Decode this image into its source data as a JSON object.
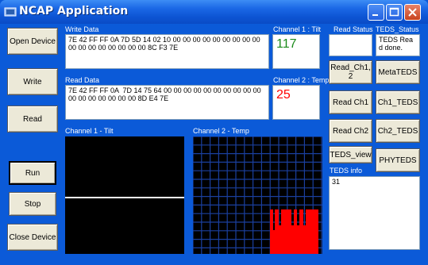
{
  "window": {
    "title": "NCAP Application"
  },
  "buttons": {
    "open_device": "Open Device",
    "write": "Write",
    "read": "Read",
    "run": "Run",
    "stop": "Stop",
    "close_device": "Close Device",
    "read_ch12": "Read_Ch1, 2",
    "meta_teds": "MetaTEDS",
    "read_ch1": "Read Ch1",
    "ch1_teds": "Ch1_TEDS",
    "read_ch2": "Read Ch2",
    "ch2_teds": "Ch2_TEDS",
    "teds_view": "TEDS_view",
    "phy_teds": "PHYTEDS"
  },
  "labels": {
    "write_data": "Write Data",
    "read_data": "Read Data",
    "channel1_tilt_value": "Channel 1 : Tilt",
    "channel2_temp_value": "Channel 2 : Temp",
    "read_status": "Read Status",
    "teds_status": "TEDS_Status",
    "channel1_plot": "Channel 1 - Tilt",
    "channel2_plot": "Channel 2 - Temp",
    "teds_info": "TEDS info"
  },
  "fields": {
    "write_data": "7E 42 FF FF 0A 7D 5D 14 02 10 00 00 00 00 00 00 00 00 00 00 00 00 00 00 00 00 00 8C F3 7E",
    "read_data": "7E 42 FF FF 0A  7D 14 75 64 00 00 00 00 00 00 00 00 00 00 00 00 00 00 00 00 00 8D E4 7E",
    "channel1_value": "117",
    "channel2_value": "25",
    "read_status": "",
    "teds_status": "TEDS Read done.",
    "teds_info": "31"
  },
  "colors": {
    "channel1_value": "#1a8a1a",
    "channel2_value": "#ff0000",
    "channel1_trace": "#ffffff",
    "channel2_fill": "#ff0000",
    "plot_background": "#000000",
    "plot_grid": "#1a3f9e"
  }
}
